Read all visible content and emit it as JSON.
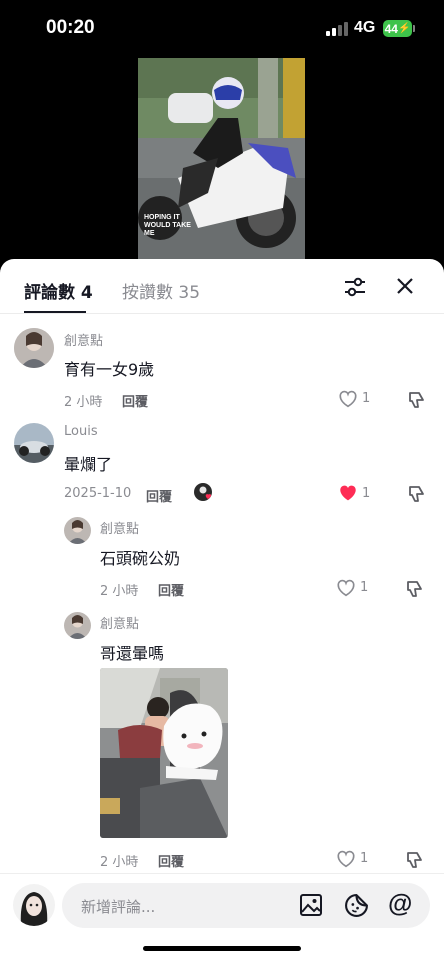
{
  "status_bar": {
    "time": "00:20",
    "network": "4G",
    "battery": "44"
  },
  "video": {
    "overlay_text_1": "HOPING IT",
    "overlay_text_2": "WOULD TAKE",
    "overlay_text_3": "ME"
  },
  "tabs": [
    {
      "label": "評論數 4",
      "active": true
    },
    {
      "label": "按讚數 35",
      "active": false
    }
  ],
  "comments": [
    {
      "username": "創意點",
      "text": "育有一女9歲",
      "time": "2 小時",
      "reply_label": "回覆",
      "likes": "1",
      "liked": false
    },
    {
      "username": "Louis",
      "text": "暈爛了",
      "time": "2025-1-10",
      "reply_label": "回覆",
      "likes": "1",
      "liked": true,
      "liked_by_creator": true
    },
    {
      "username": "創意點",
      "text": "石頭碗公奶",
      "time": "2 小時",
      "reply_label": "回覆",
      "likes": "1",
      "liked": false,
      "is_reply": true
    },
    {
      "username": "創意點",
      "text": "哥還暈嗎",
      "time": "2 小時",
      "reply_label": "回覆",
      "likes": "1",
      "liked": false,
      "is_reply": true,
      "has_image": true
    }
  ],
  "composer": {
    "placeholder": "新增評論..."
  },
  "colors": {
    "accent_red": "#fe2c55",
    "battery_green": "#3ec34a",
    "text_primary": "#161823",
    "text_secondary": "#8a8b91"
  },
  "icons": [
    "filter-icon",
    "close-icon",
    "heart-icon",
    "dislike-icon",
    "image-icon",
    "sticker-icon",
    "mention-icon"
  ]
}
